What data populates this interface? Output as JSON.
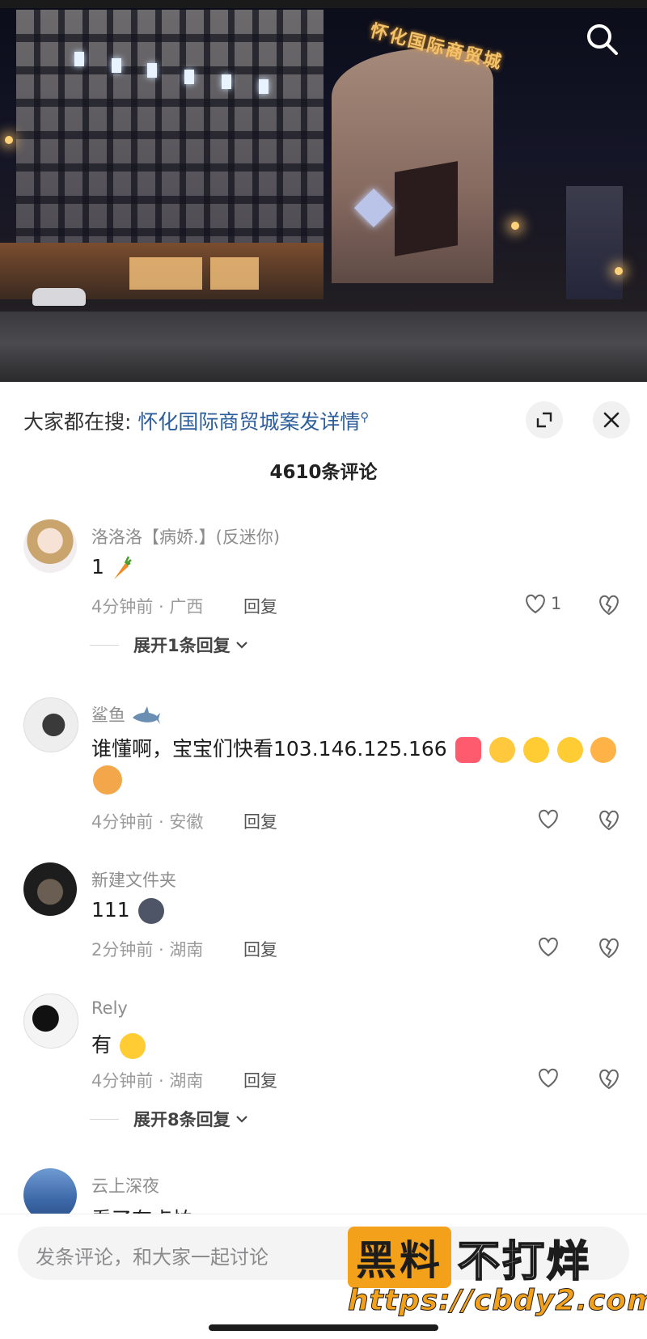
{
  "header": {
    "hot_search_prefix": "大家都在搜:",
    "hot_search_query": "怀化国际商贸城案发详情",
    "comment_count": "4610条评论"
  },
  "video": {
    "sign_text": "怀化国际商贸城"
  },
  "comments": [
    {
      "name": "洛洛洛【病娇.】(反迷你)",
      "text": "1",
      "emoji": [
        "carrot"
      ],
      "time": "4分钟前",
      "location": "广西",
      "reply": "回复",
      "likes": "1",
      "expand": "展开1条回复"
    },
    {
      "name": "鲨鱼",
      "text": "谁懂啊，宝宝们快看103.146.125.166",
      "time": "4分钟前",
      "location": "安徽",
      "reply": "回复",
      "likes": ""
    },
    {
      "name": "新建文件夹",
      "text": "111",
      "time": "2分钟前",
      "location": "湖南",
      "reply": "回复",
      "likes": ""
    },
    {
      "name": "Rely",
      "text": "有",
      "time": "4分钟前",
      "location": "湖南",
      "reply": "回复",
      "likes": "",
      "expand": "展开8条回复"
    },
    {
      "name": "云上深夜",
      "text": "看了有点怕"
    }
  ],
  "input": {
    "placeholder": "发条评论，和大家一起讨论"
  },
  "watermark": {
    "box_text": "黑料",
    "rest_text": "不打烊",
    "url": "https://cbdy2.com"
  },
  "colors": {
    "link": "#2d5e9c",
    "watermark_orange": "#f3a01a"
  }
}
